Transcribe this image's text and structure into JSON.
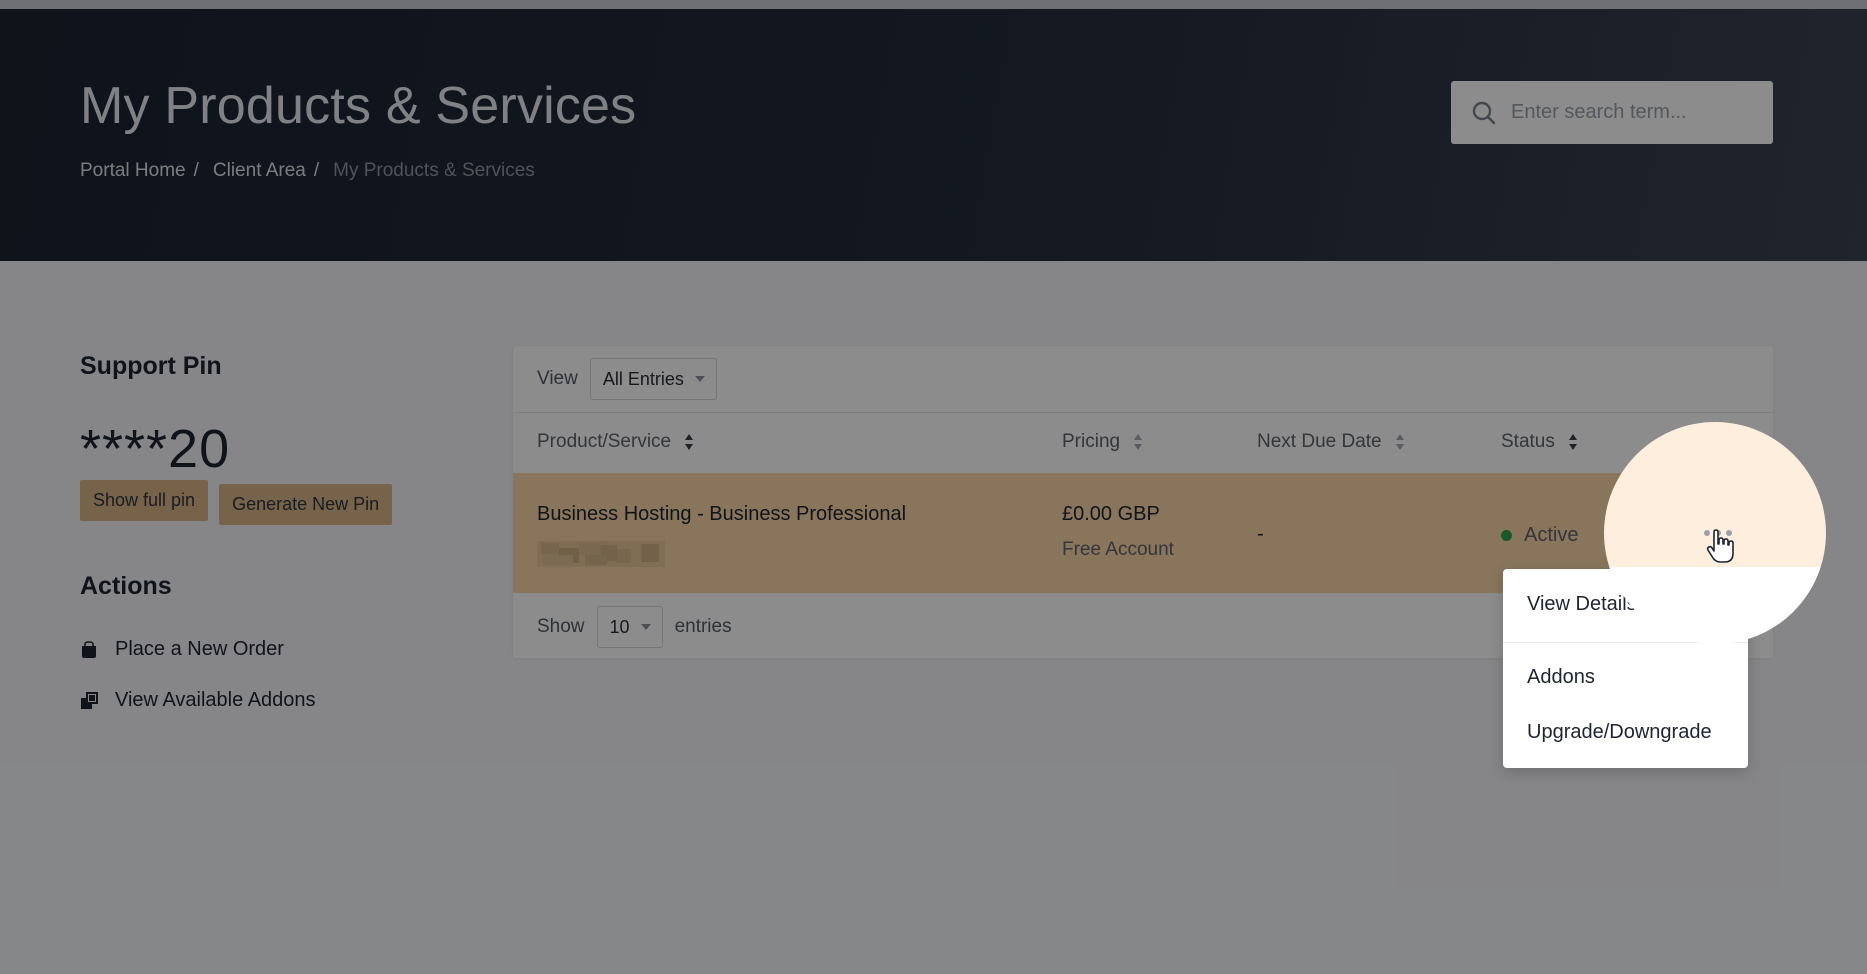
{
  "header": {
    "title": "My Products & Services",
    "breadcrumb": [
      "Portal Home",
      "Client Area",
      "My Products & Services"
    ],
    "breadcrumb_separator": "/",
    "search_placeholder": "Enter search term..."
  },
  "sidebar": {
    "support_pin_title": "Support Pin",
    "pin_value": "****20",
    "show_pin_label": "Show full pin",
    "generate_pin_label": "Generate New Pin",
    "actions_title": "Actions",
    "actions": [
      {
        "label": "Place a New Order",
        "icon": "shopping-bag-icon"
      },
      {
        "label": "View Available Addons",
        "icon": "addons-icon"
      }
    ]
  },
  "table": {
    "view_label": "View",
    "view_selected": "All Entries",
    "columns": [
      "Product/Service",
      "Pricing",
      "Next Due Date",
      "Status"
    ],
    "rows": [
      {
        "product": "Business Hosting - Business Professional",
        "price": "£0.00 GBP",
        "cycle": "Free Account",
        "next_due": "-",
        "status": "Active"
      }
    ],
    "show_label": "Show",
    "show_selected": "10",
    "entries_label": "entries"
  },
  "row_menu": {
    "items": [
      "View Details",
      "Addons",
      "Upgrade/Downgrade"
    ]
  },
  "colors": {
    "highlight_row": "#f7d6a8",
    "button_tan": "#d8b586",
    "status_active": "#2fa04f",
    "hero_dark": "#1c2331"
  }
}
